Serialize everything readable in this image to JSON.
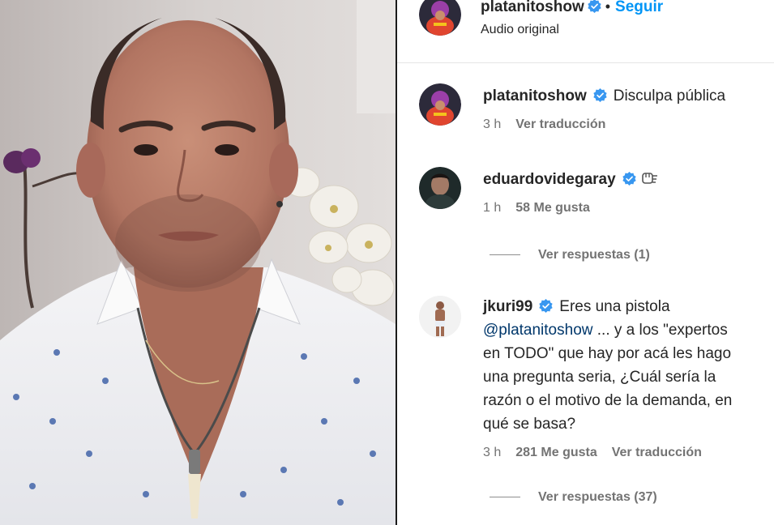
{
  "header": {
    "username": "platanitoshow",
    "separator": "•",
    "follow_label": "Seguir",
    "audio_label": "Audio original"
  },
  "comments": [
    {
      "username": "platanitoshow",
      "verified": true,
      "text": "Disculpa pública",
      "time": "3 h",
      "translate_label": "Ver traducción"
    },
    {
      "username": "eduardovidegaray",
      "verified": true,
      "emoji_icon": "fist-bump-icon",
      "time": "1 h",
      "likes": "58 Me gusta",
      "replies_label": "Ver respuestas (1)"
    },
    {
      "username": "jkuri99",
      "verified": true,
      "text_line1": "Eres una pistola",
      "mention": "@platanitoshow",
      "text_line2_rest": " ... y a los \"expertos",
      "text_line3": "en TODO\" que hay por acá les hago",
      "text_line4": "una pregunta seria, ¿Cuál sería la",
      "text_line5": "razón o el motivo de la demanda, en",
      "text_line6": "qué se basa?",
      "time": "3 h",
      "likes": "281 Me gusta",
      "translate_label": "Ver traducción",
      "replies_label": "Ver respuestas (37)"
    }
  ],
  "colors": {
    "link_blue": "#0095f6",
    "mention_blue": "#00376b",
    "muted_gray": "#737373",
    "verified_blue": "#3897f0"
  }
}
